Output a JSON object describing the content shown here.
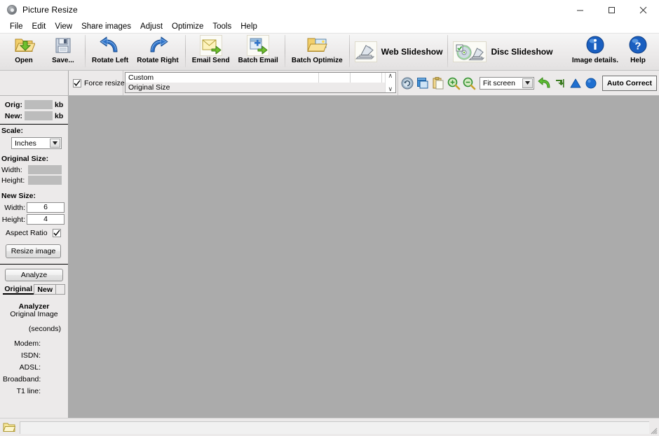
{
  "window": {
    "title": "Picture Resize",
    "app_icon": "disc-icon",
    "controls": {
      "minimize": "minimize-icon",
      "maximize": "maximize-icon",
      "close": "close-icon"
    }
  },
  "menubar": {
    "items": [
      {
        "label": "File"
      },
      {
        "label": "Edit"
      },
      {
        "label": "View"
      },
      {
        "label": "Share images"
      },
      {
        "label": "Adjust"
      },
      {
        "label": "Optimize"
      },
      {
        "label": "Tools"
      },
      {
        "label": "Help"
      }
    ]
  },
  "toolbar": {
    "buttons": [
      {
        "label": "Open",
        "icon": "open-folder-icon"
      },
      {
        "label": "Save...",
        "icon": "floppy-disk-icon"
      },
      {
        "label": "Rotate Left",
        "icon": "rotate-left-icon"
      },
      {
        "label": "Rotate Right",
        "icon": "rotate-right-icon"
      },
      {
        "label": "Email Send",
        "icon": "email-send-icon"
      },
      {
        "label": "Batch Email",
        "icon": "batch-email-icon"
      },
      {
        "label": "Batch Optimize",
        "icon": "batch-optimize-icon"
      }
    ],
    "inline_buttons": [
      {
        "label": "Web Slideshow",
        "icon": "web-slideshow-icon"
      },
      {
        "label": "Disc Slideshow",
        "icon": "disc-slideshow-icon"
      }
    ],
    "right_buttons": [
      {
        "label": "Image details.",
        "icon": "info-icon"
      },
      {
        "label": "Help",
        "icon": "help-question-icon"
      }
    ]
  },
  "row2": {
    "force_resize": {
      "label": "Force resize",
      "checked": true
    },
    "presets": [
      {
        "label": "Custom",
        "selected": false
      },
      {
        "label": "Original Size",
        "selected": true
      }
    ],
    "scroll_up": "∧",
    "scroll_down": "∨",
    "tools": [
      {
        "icon": "refresh-circle-icon"
      },
      {
        "icon": "window-copy-icon"
      },
      {
        "icon": "clipboard-paste-icon"
      },
      {
        "icon": "zoom-in-icon"
      },
      {
        "icon": "zoom-out-icon"
      }
    ],
    "zoom_select": {
      "value": "Fit screen",
      "arrow": "▼"
    },
    "tools_right": [
      {
        "icon": "undo-arrow-icon"
      },
      {
        "icon": "flip-icon"
      },
      {
        "icon": "triangle-up-icon"
      },
      {
        "icon": "circle-icon"
      }
    ],
    "auto_correct": {
      "label": "Auto Correct"
    }
  },
  "sidebar": {
    "filesize": {
      "orig_label": "Orig:",
      "orig_value": "",
      "orig_unit": "kb",
      "new_label": "New:",
      "new_value": "",
      "new_unit": "kb"
    },
    "scale": {
      "heading": "Scale:",
      "unit_value": "Inches",
      "arrow": "▼"
    },
    "original_size": {
      "heading": "Original Size:",
      "width_label": "Width:",
      "width_value": "",
      "height_label": "Height:",
      "height_value": ""
    },
    "new_size": {
      "heading": "New Size:",
      "width_label": "Width:",
      "width_value": "6",
      "height_label": "Height:",
      "height_value": "4",
      "aspect_label": "Aspect Ratio",
      "aspect_checked": true,
      "resize_button": "Resize image"
    },
    "analyze": {
      "button": "Analyze",
      "tabs": [
        {
          "label": "Original",
          "active": true
        },
        {
          "label": "New",
          "active": false
        }
      ],
      "title": "Analyzer",
      "subtitle": "Original Image",
      "units": "(seconds)",
      "rows": [
        {
          "label": "Modem:",
          "value": ""
        },
        {
          "label": "ISDN:",
          "value": ""
        },
        {
          "label": "ADSL:",
          "value": ""
        },
        {
          "label": "Broadband:",
          "value": ""
        },
        {
          "label": "T1 line:",
          "value": ""
        }
      ]
    }
  },
  "canvas": {
    "background": "#ababab",
    "content": ""
  },
  "statusbar": {
    "folder_icon": "folder-icon",
    "path_value": "",
    "resize_grip": "resize-grip-icon"
  },
  "colors": {
    "window_bg": "#f0f0f0",
    "panel_bg": "#eceaea",
    "canvas_bg": "#ababab",
    "field_gray": "#bcbcbc",
    "accent_blue": "#1f6fd0",
    "accent_green": "#5bb42b"
  }
}
